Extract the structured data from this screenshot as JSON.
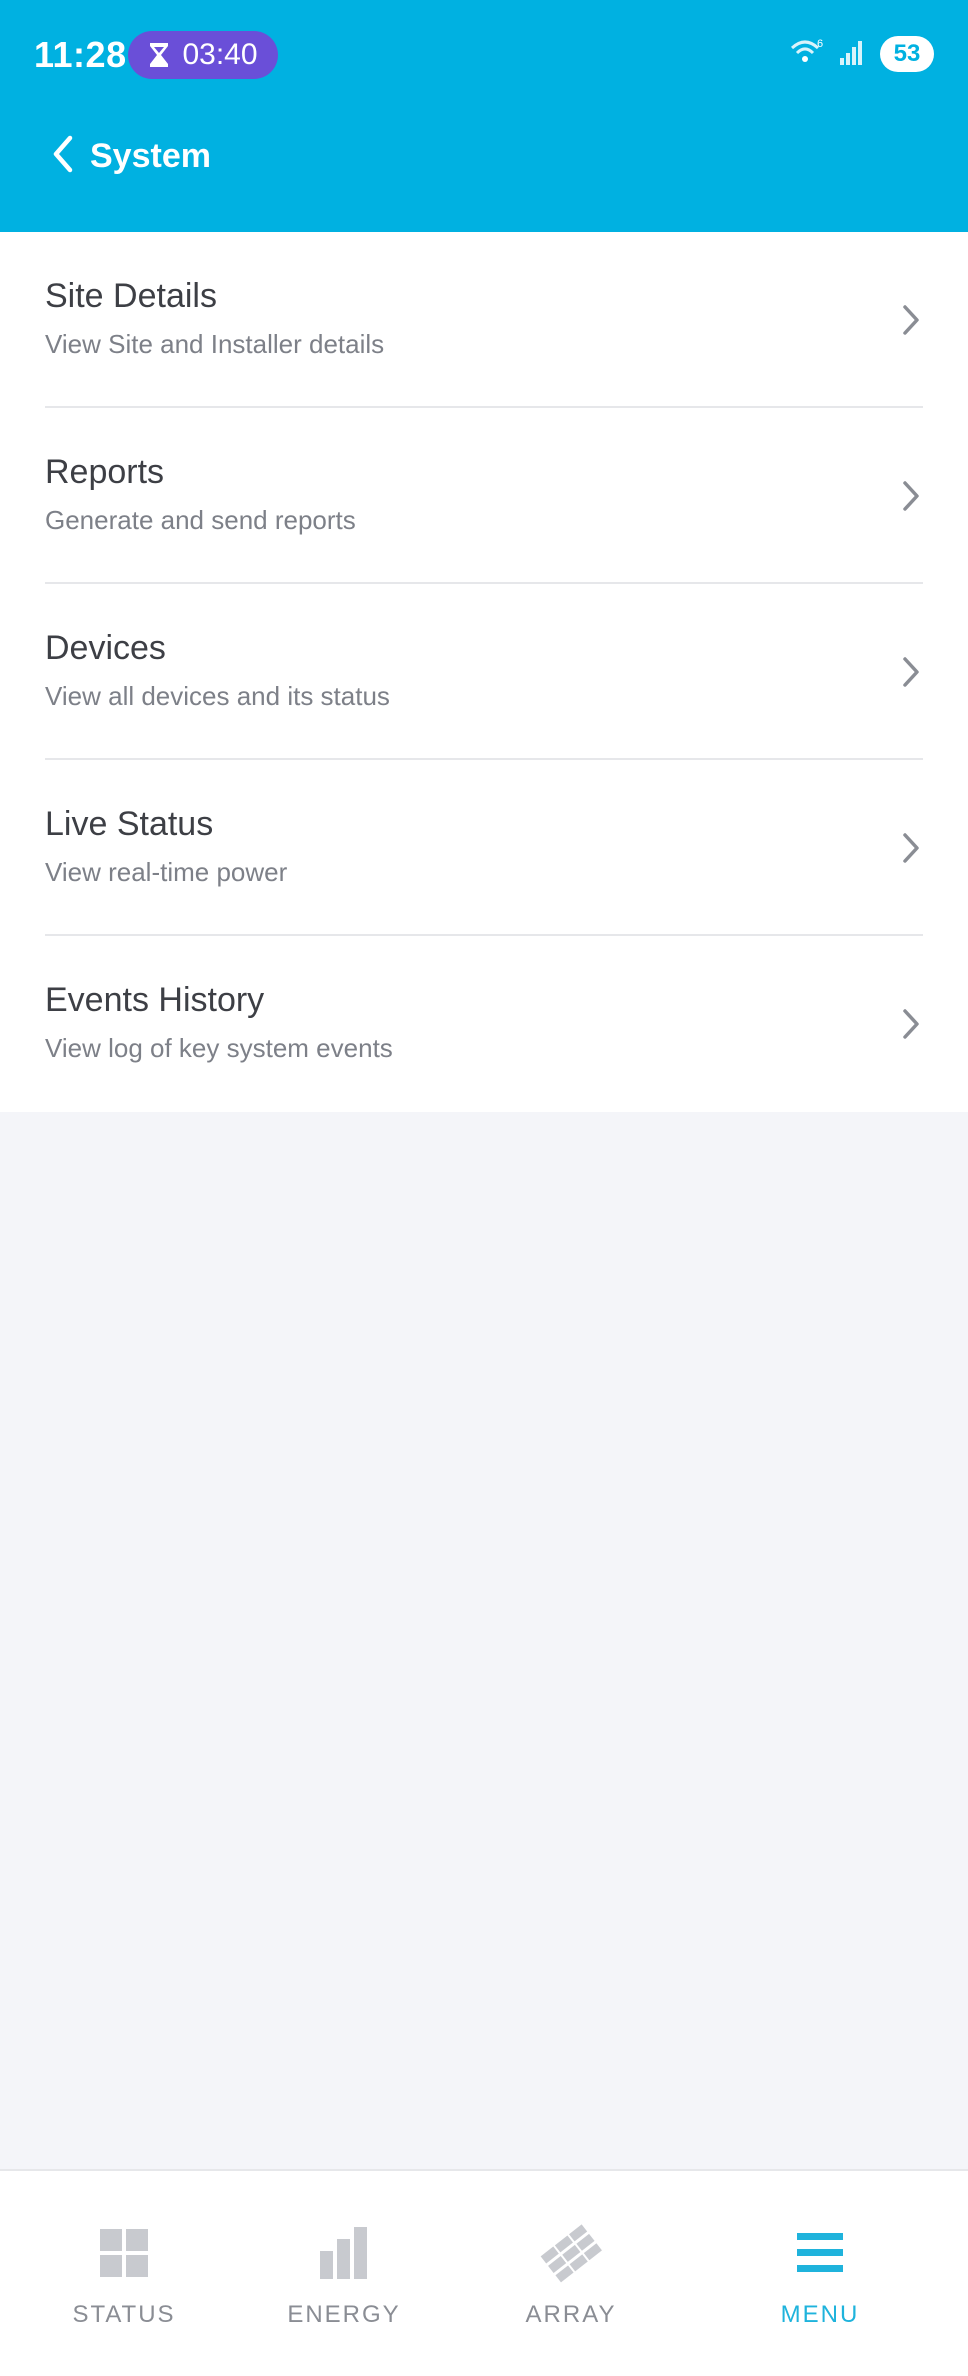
{
  "status_bar": {
    "time": "11:28",
    "timer": "03:40",
    "battery": "53",
    "icons": [
      "hourglass-icon",
      "wifi-icon",
      "signal-icon",
      "battery-icon"
    ]
  },
  "header": {
    "title": "System",
    "back_icon": "chevron-left-icon"
  },
  "menu_items": [
    {
      "title": "Site Details",
      "subtitle": "View Site and Installer details"
    },
    {
      "title": "Reports",
      "subtitle": "Generate and send reports"
    },
    {
      "title": "Devices",
      "subtitle": "View all devices and its status"
    },
    {
      "title": "Live Status",
      "subtitle": "View real-time power"
    },
    {
      "title": "Events History",
      "subtitle": "View log of key system events"
    }
  ],
  "tabs": [
    {
      "label": "STATUS",
      "icon": "grid-icon",
      "active": false
    },
    {
      "label": "ENERGY",
      "icon": "bar-chart-icon",
      "active": false
    },
    {
      "label": "ARRAY",
      "icon": "panel-array-icon",
      "active": false
    },
    {
      "label": "MENU",
      "icon": "hamburger-menu-icon",
      "active": true
    }
  ],
  "colors": {
    "header_bg": "#00b1e1",
    "timer_pill": "#6a4fd8",
    "active_tab": "#1fb3dc",
    "inactive_tab": "#8a8d94",
    "page_bg": "#f4f5f9"
  }
}
